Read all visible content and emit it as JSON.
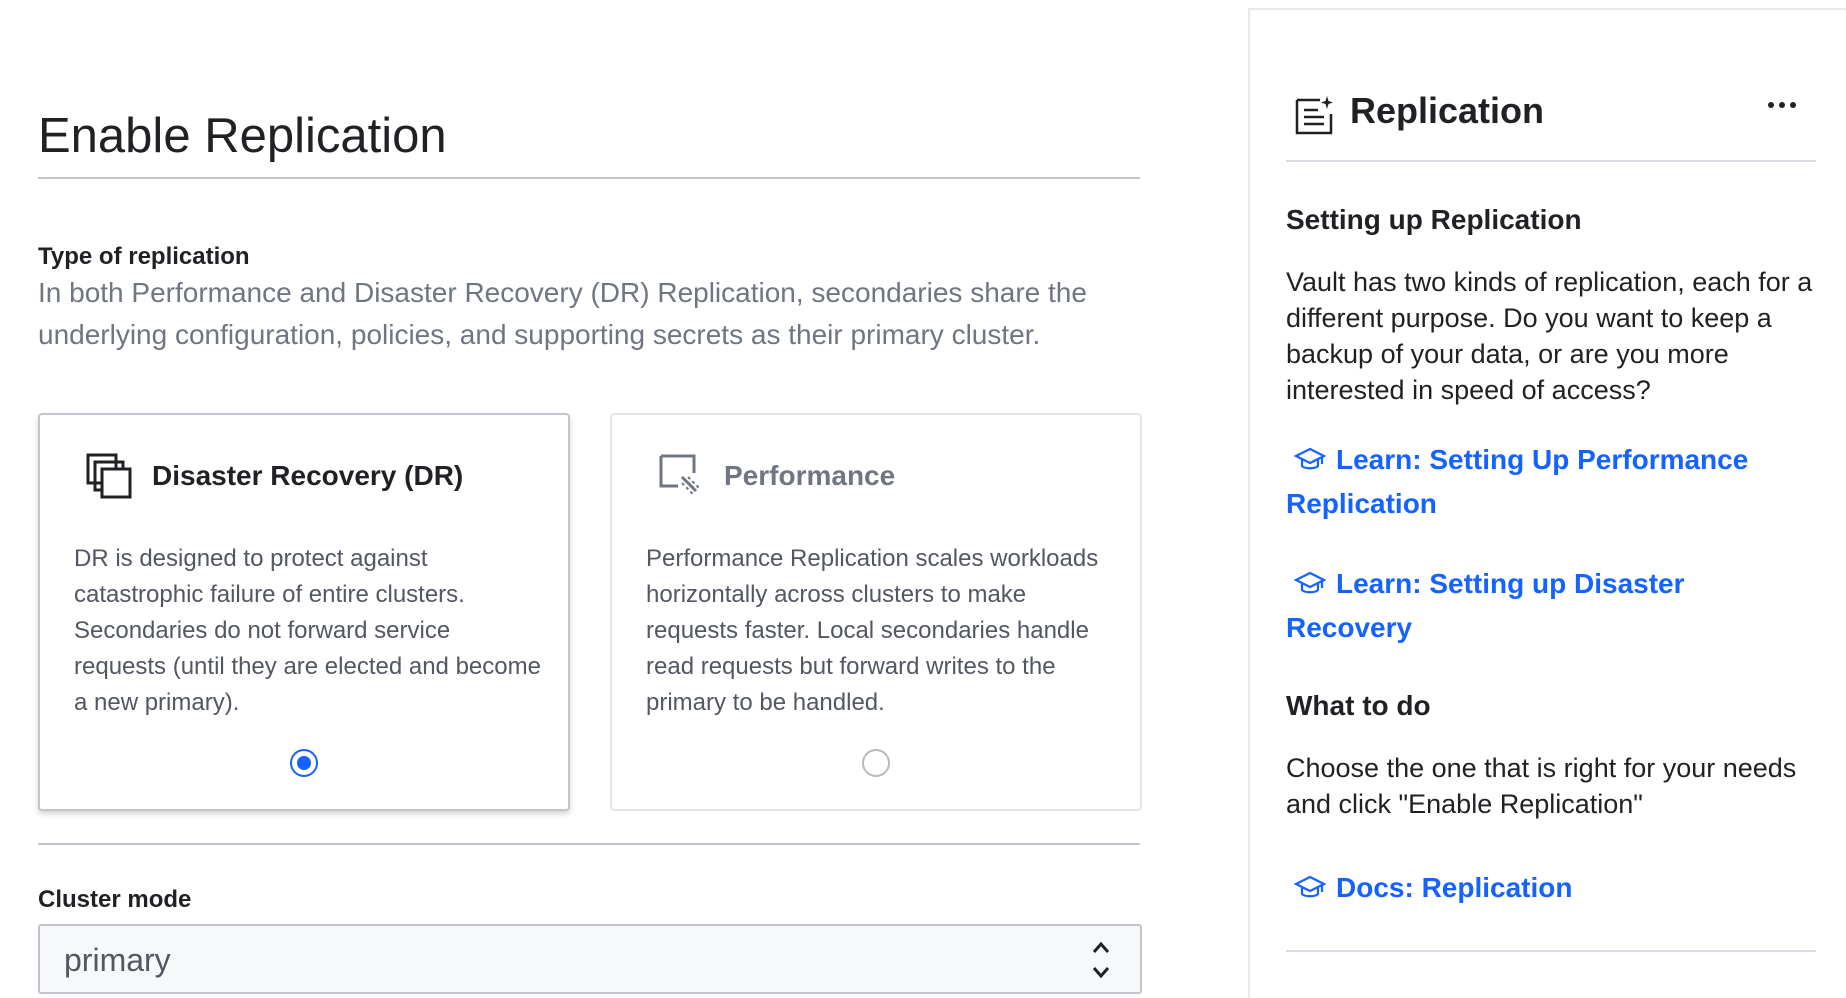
{
  "page": {
    "title": "Enable Replication"
  },
  "type_section": {
    "label": "Type of replication",
    "help": "In both Performance and Disaster Recovery (DR) Replication, secondaries share the underlying configuration, policies, and supporting secrets as their primary cluster."
  },
  "cards": [
    {
      "title": "Disaster Recovery (DR)",
      "icon": "disaster-recovery-icon",
      "body": "DR is designed to protect against catastrophic failure of entire clusters. Secondaries do not forward service requests (until they are elected and become a new primary).",
      "selected": true
    },
    {
      "title": "Performance",
      "icon": "performance-icon",
      "body": "Performance Replication scales workloads horizontally across clusters to make requests faster. Local secondaries handle read requests but forward writes to the primary to be handled.",
      "selected": false
    }
  ],
  "cluster_mode": {
    "label": "Cluster mode",
    "value": "primary"
  },
  "panel": {
    "title": "Replication",
    "setup_heading": "Setting up Replication",
    "setup_text": "Vault has two kinds of replication, each for a different purpose. Do you want to keep a backup of your data, or are you more interested in speed of access?",
    "links": [
      {
        "label": "Learn: Setting Up Performance Replication"
      },
      {
        "label": "Learn: Setting up Disaster Recovery"
      }
    ],
    "todo_heading": "What to do",
    "todo_text": "Choose the one that is right for your needs and click \"Enable Replication\"",
    "docs_link": "Docs: Replication"
  },
  "colors": {
    "accent": "#1563ff",
    "text": "#1f2124",
    "muted": "#6f7682"
  }
}
